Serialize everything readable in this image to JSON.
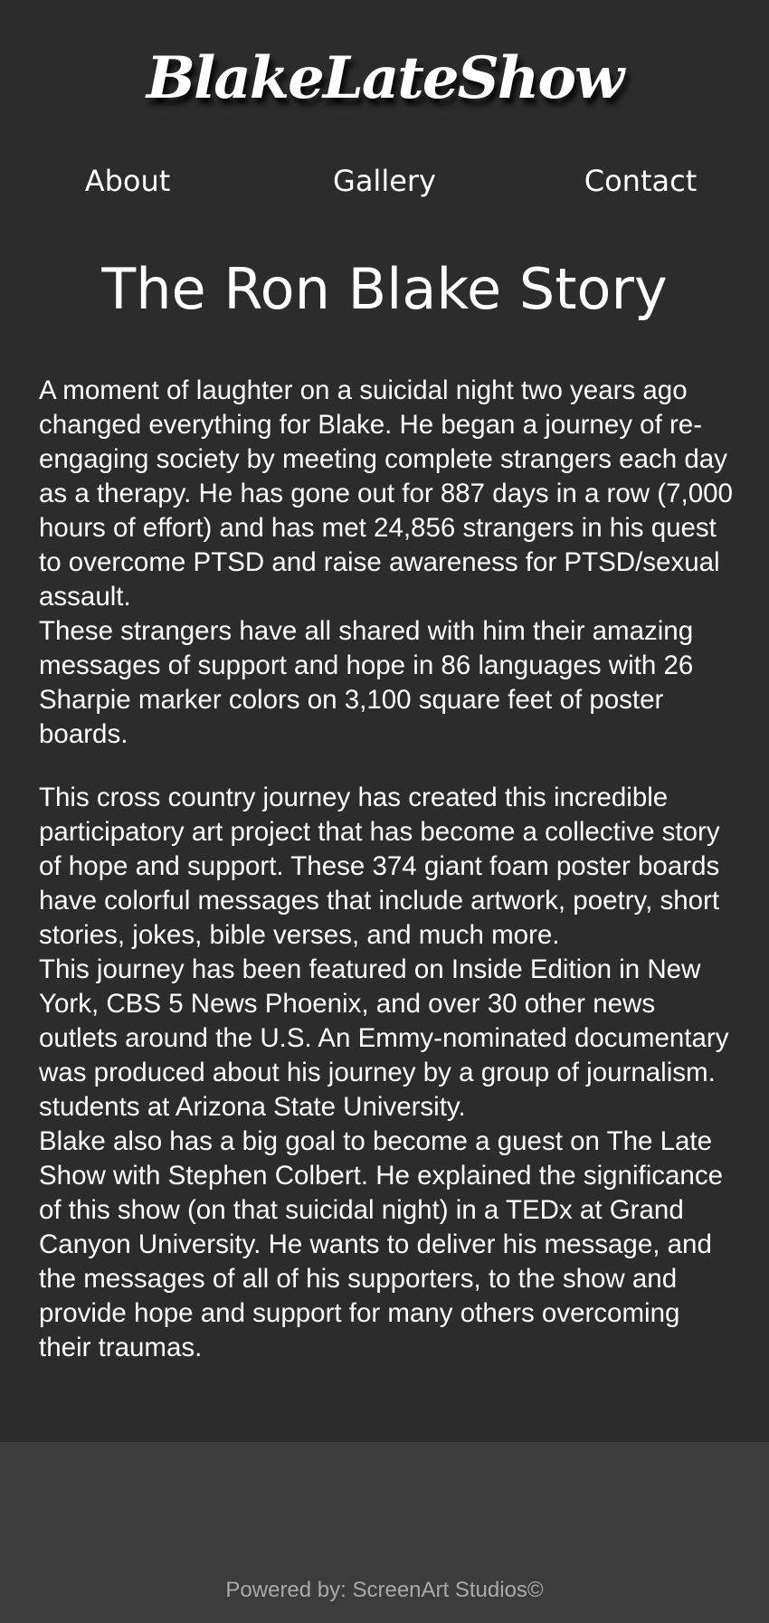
{
  "header": {
    "logo_text": "BlakeLateShow"
  },
  "nav": {
    "items": [
      {
        "label": "About"
      },
      {
        "label": "Gallery"
      },
      {
        "label": "Contact"
      }
    ]
  },
  "main": {
    "title": "The Ron Blake Story",
    "paragraphs": [
      "A moment of laughter on a suicidal night two years ago changed everything for Blake. He began a journey of re-engaging society by meeting complete strangers each day as a therapy. He has gone out for 887 days in a row (7,000 hours of effort) and has met 24,856 strangers in his quest to overcome PTSD and raise awareness for PTSD/sexual assault.",
      "These strangers have all shared with him their amazing messages of support and hope in 86 languages with 26 Sharpie marker colors on 3,100 square feet of poster boards.",
      "This cross country journey has created this incredible participatory art project that has become a collective story of hope and support. These 374 giant foam poster boards have colorful messages that include artwork, poetry, short stories, jokes, bible verses, and much more.",
      "This journey has been featured on Inside Edition in New York, CBS 5 News Phoenix, and over 30 other news outlets around the U.S. An Emmy-nominated documentary was produced about his journey by a group of journalism. students at Arizona State University.",
      "Blake also has a big goal to become a guest on The Late Show with Stephen Colbert. He explained the significance of this show (on that suicidal night) in a TEDx at Grand Canyon University. He wants to deliver his message, and the messages of all of his supporters, to the show and provide hope and support for many others overcoming their traumas."
    ]
  },
  "footer": {
    "text": "Powered by: ScreenArt Studios©"
  },
  "colors": {
    "background": "#2c2c2c",
    "footer_background": "#3c3c3c",
    "footer_text": "#a9a9a9",
    "text": "#ffffff"
  }
}
